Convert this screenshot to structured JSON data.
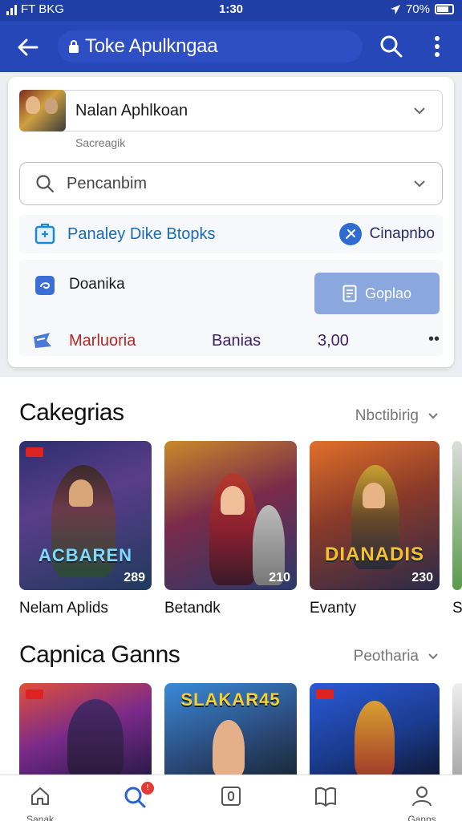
{
  "status_bar": {
    "carrier": "FT BKG",
    "time": "1:30",
    "battery": "70%"
  },
  "app_bar": {
    "title": "Toke Apulkngaa"
  },
  "form": {
    "app_select_label": "Nalan Aphlkoan",
    "helper": "Sacreagik",
    "search_placeholder": "Pencanbim",
    "row_a_label": "Panaley Dike Btopks",
    "row_a_right": "Cinapnbo",
    "donation_label": "Doanika",
    "display_button": "Goplao",
    "mart_label": "Marluoria",
    "games_label": "Banias",
    "price": "3,00",
    "more": "••"
  },
  "sections": [
    {
      "title": "Cakegrias",
      "action": "Nbctibirig",
      "items": [
        {
          "caption": "Nelam Aplids",
          "badge_num": "289",
          "logo": "ACBAREN"
        },
        {
          "caption": "Betandk",
          "badge_num": "210",
          "logo": ""
        },
        {
          "caption": "Evanty",
          "badge_num": "230",
          "logo": "DIANADIS"
        },
        {
          "caption": "S",
          "badge_num": "",
          "logo": ""
        }
      ]
    },
    {
      "title": "Capnica Ganns",
      "action": "Peotharia",
      "items": [
        {
          "caption": "",
          "badge_num": "",
          "logo": ""
        },
        {
          "caption": "",
          "badge_num": "",
          "logo": "SLAKAR45"
        },
        {
          "caption": "",
          "badge_num": "",
          "logo": ""
        }
      ]
    }
  ],
  "bottom_nav": [
    {
      "label": "Sanak",
      "icon": "home-icon"
    },
    {
      "label": "",
      "icon": "search-icon",
      "badge": "!"
    },
    {
      "label": "",
      "icon": "square-icon"
    },
    {
      "label": "",
      "icon": "book-icon"
    },
    {
      "label": "Ganns",
      "icon": "profile-icon"
    }
  ],
  "colors": {
    "primary": "#2547b8",
    "status": "#1f3fa6",
    "accent_blue": "#1a6bb8",
    "accent_red": "#b3262a",
    "button": "#8aa8dd"
  }
}
